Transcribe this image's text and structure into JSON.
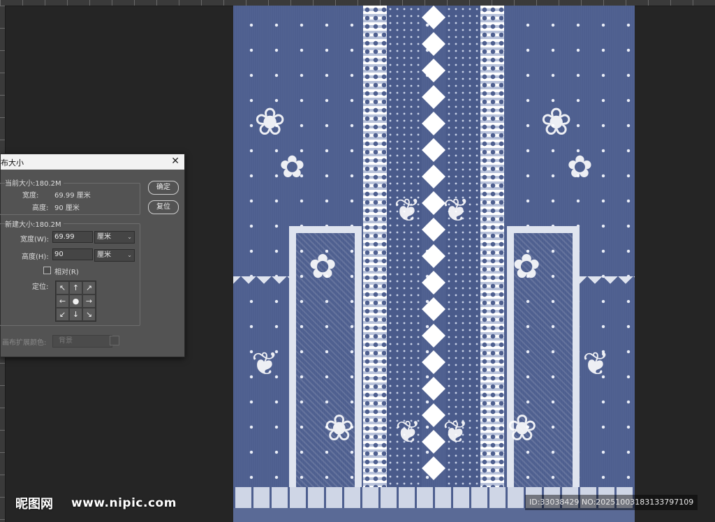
{
  "dialog": {
    "title": "布大小",
    "close_icon": "✕",
    "current_size": {
      "label": "当前大小:180.2M",
      "width_label": "宽度:",
      "width_value": "69.99 厘米",
      "height_label": "高度:",
      "height_value": "90 厘米"
    },
    "new_size": {
      "label": "新建大小:180.2M",
      "width_label": "宽度(W):",
      "width_value": "69.99",
      "width_unit": "厘米",
      "height_label": "高度(H):",
      "height_value": "90",
      "height_unit": "厘米",
      "relative_label": "相对(R)",
      "anchor_label": "定位:"
    },
    "ok_label": "确定",
    "reset_label": "复位",
    "extension_color_label": "画布扩展颜色:",
    "extension_color_value": "背景"
  },
  "watermark": {
    "logo_text": "昵图网",
    "url_text": "www.nipic.com",
    "id_text": "ID:33038429 NO:20251003183133797109"
  },
  "colors": {
    "fabric_blue": "#4e5f8f",
    "lace_white": "#dfe4ef",
    "dialog_bg": "#535353",
    "workspace_bg": "#252525"
  }
}
